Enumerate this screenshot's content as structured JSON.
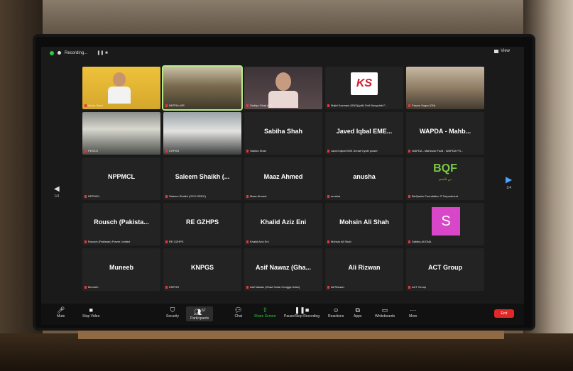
{
  "screen": {
    "recording_label": "Recording...",
    "view_label": "View"
  },
  "tiles": [
    {
      "label": "Azhar Syed",
      "name": "",
      "kind": "video"
    },
    {
      "label": "NEPRA-WR",
      "name": "",
      "kind": "video"
    },
    {
      "label": "Sadiqa Ghaji (SN)",
      "name": "",
      "kind": "video"
    },
    {
      "label": "Majid Kazmani (SNS)(pdf) Grid Bongolab F...",
      "name": "",
      "kind": "logo"
    },
    {
      "label": "Fawan Sugar (DN)",
      "name": "",
      "kind": "video"
    },
    {
      "label": "PESCO",
      "name": "",
      "kind": "video"
    },
    {
      "label": "CHPGS",
      "name": "",
      "kind": "video"
    },
    {
      "label": "Sabiha Shah",
      "name": "Sabiha Shah",
      "kind": "name"
    },
    {
      "label": "Javed Iqbal EME Jinnah hydel power",
      "name": "Javed Iqbal EME...",
      "kind": "name"
    },
    {
      "label": "WAPDA - Mahboob Fadil - WAPDA PO...",
      "name": "WAPDA - Mahb...",
      "kind": "name"
    },
    {
      "label": "NPPMCL",
      "name": "NPPMCL",
      "kind": "name"
    },
    {
      "label": "Saleem Shaikh (CEO-SRDC)",
      "name": "Saleem Shaikh (...",
      "kind": "name"
    },
    {
      "label": "Maaz Ahmed",
      "name": "Maaz Ahmed",
      "kind": "name"
    },
    {
      "label": "anusha",
      "name": "anusha",
      "kind": "name"
    },
    {
      "label": "BinQasim Foundation IT Department",
      "name": "",
      "kind": "bqf"
    },
    {
      "label": "Rousch (Pakistan) Power Limited",
      "name": "Rousch (Pakista...",
      "kind": "name"
    },
    {
      "label": "RE GZHPS",
      "name": "RE GZHPS",
      "kind": "name"
    },
    {
      "label": "Khalid Aziz Eni",
      "name": "Khalid Aziz Eni",
      "kind": "name"
    },
    {
      "label": "Mohsin Ali Shah",
      "name": "Mohsin Ali Shah",
      "kind": "name"
    },
    {
      "label": "Sabiha Ali DNA",
      "name": "",
      "kind": "avatar"
    },
    {
      "label": "Muneeb",
      "name": "Muneeb",
      "kind": "name"
    },
    {
      "label": "KNPGS",
      "name": "KNPGS",
      "kind": "name"
    },
    {
      "label": "Asif Nawaz (Ghazi Solar Hongga Solar)",
      "name": "Asif Nawaz (Gha...",
      "kind": "name"
    },
    {
      "label": "Ali Rizwan",
      "name": "Ali Rizwan",
      "kind": "name"
    },
    {
      "label": "ACT Group",
      "name": "ACT Group",
      "kind": "name"
    }
  ],
  "logos": {
    "ks": "KS",
    "bqf": "BQF",
    "bqf_sub": "بن قاسم",
    "avatar_letter": "S"
  },
  "nav": {
    "left_page": "1/4",
    "right_page": "1/4"
  },
  "toolbar": {
    "mute": "Mute",
    "stop_video": "Stop Video",
    "security": "Security",
    "participants": "Participants",
    "participants_count": "67",
    "chat": "Chat",
    "share_screen": "Share Screen",
    "record": "Pause/Stop Recording",
    "reactions": "Reactions",
    "apps": "Apps",
    "whiteboards": "Whiteboards",
    "more": "More",
    "end": "End"
  }
}
